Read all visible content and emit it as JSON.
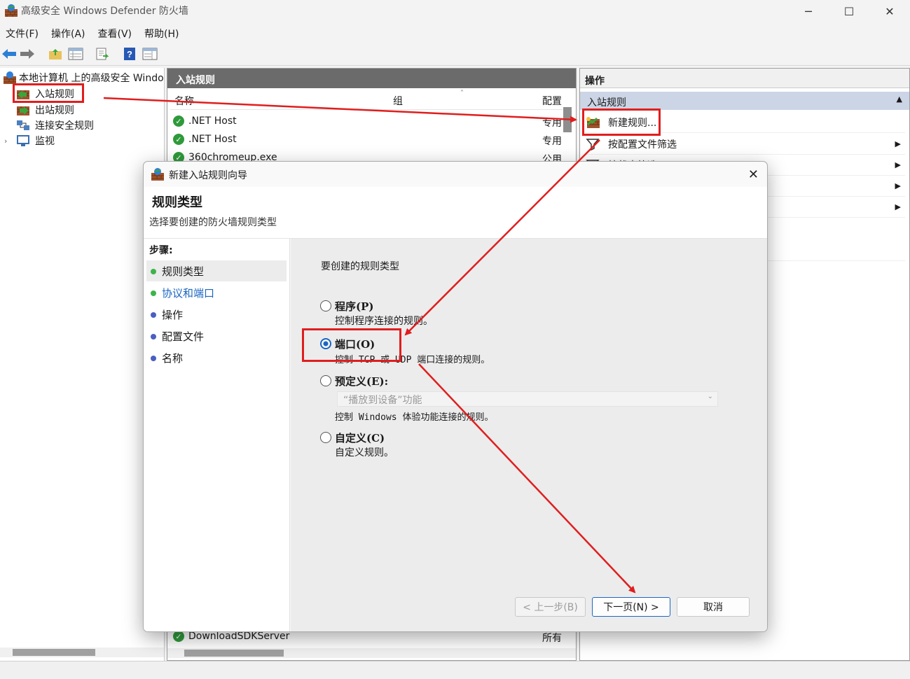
{
  "window": {
    "title": "高级安全 Windows Defender 防火墙"
  },
  "menu": [
    "文件(F)",
    "操作(A)",
    "查看(V)",
    "帮助(H)"
  ],
  "tree": {
    "root": "本地计算机 上的高级安全 Windows Defender 防火墙",
    "items": [
      "入站规则",
      "出站规则",
      "连接安全规则",
      "监视"
    ]
  },
  "list": {
    "header": "入站规则",
    "columns": {
      "name": "名称",
      "group": "组",
      "profile": "配置"
    },
    "rows": [
      {
        "name": ".NET Host",
        "profile": "专用"
      },
      {
        "name": ".NET Host",
        "profile": "专用"
      },
      {
        "name": "360chromeup.exe",
        "profile": "公用"
      },
      {
        "name": "DownloadSDKServer",
        "profile": "所有"
      }
    ]
  },
  "actions": {
    "header": "操作",
    "section": "入站规则",
    "items": [
      "新建规则...",
      "按配置文件筛选",
      "按状态筛选"
    ]
  },
  "dialog": {
    "title": "新建入站规则向导",
    "heading": "规则类型",
    "subheading": "选择要创建的防火墙规则类型",
    "steps_title": "步骤:",
    "steps": [
      "规则类型",
      "协议和端口",
      "操作",
      "配置文件",
      "名称"
    ],
    "prompt": "要创建的规则类型",
    "options": [
      {
        "label": "程序(P)",
        "desc": "控制程序连接的规则。",
        "selected": false
      },
      {
        "label": "端口(O)",
        "desc": "控制 TCP 或 UDP 端口连接的规则。",
        "selected": true
      },
      {
        "label": "预定义(E):",
        "desc": "控制 Windows 体验功能连接的规则。",
        "selected": false,
        "combo": "“播放到设备”功能"
      },
      {
        "label": "自定义(C)",
        "desc": "自定义规则。",
        "selected": false
      }
    ],
    "buttons": {
      "back": "< 上一步(B)",
      "next": "下一页(N) >",
      "cancel": "取消"
    }
  },
  "colors": {
    "highlight": "#e01e1e",
    "accent": "#1a66c2",
    "link": "#1a66c2"
  }
}
